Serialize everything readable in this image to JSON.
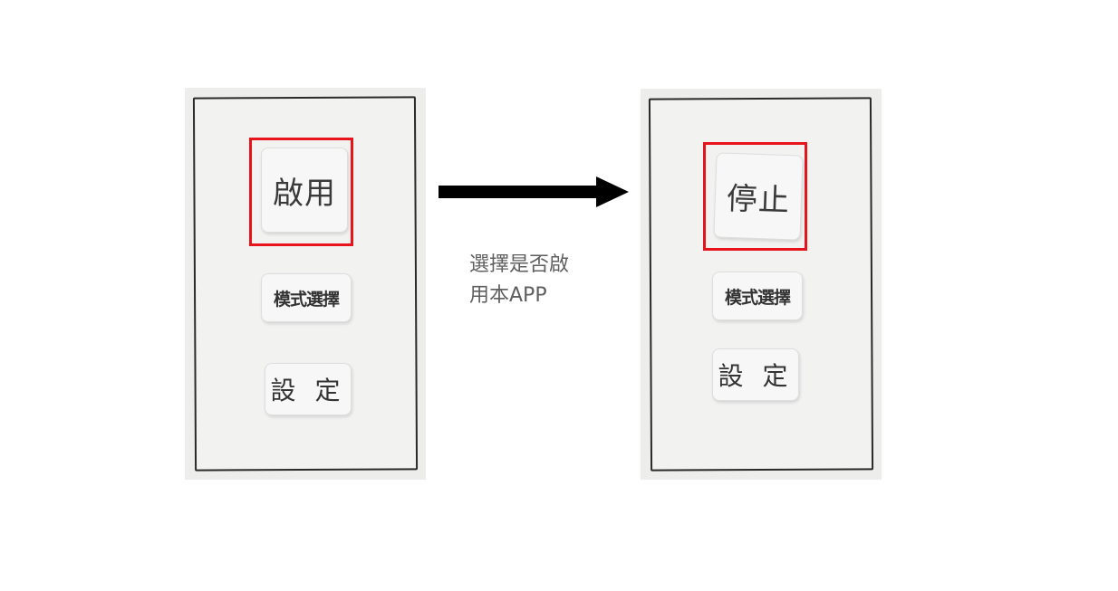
{
  "left_screen": {
    "main_button_label": "啟用",
    "mode_button_label": "模式選擇",
    "settings_button_label": "設 定"
  },
  "right_screen": {
    "main_button_label": "停止",
    "mode_button_label": "模式選擇",
    "settings_button_label": "設 定"
  },
  "caption": {
    "line1": "選擇是否啟",
    "line2": "用本APP"
  },
  "colors": {
    "highlight": "#e8141b",
    "arrow": "#000000",
    "caption_text": "#5f5f5f"
  }
}
